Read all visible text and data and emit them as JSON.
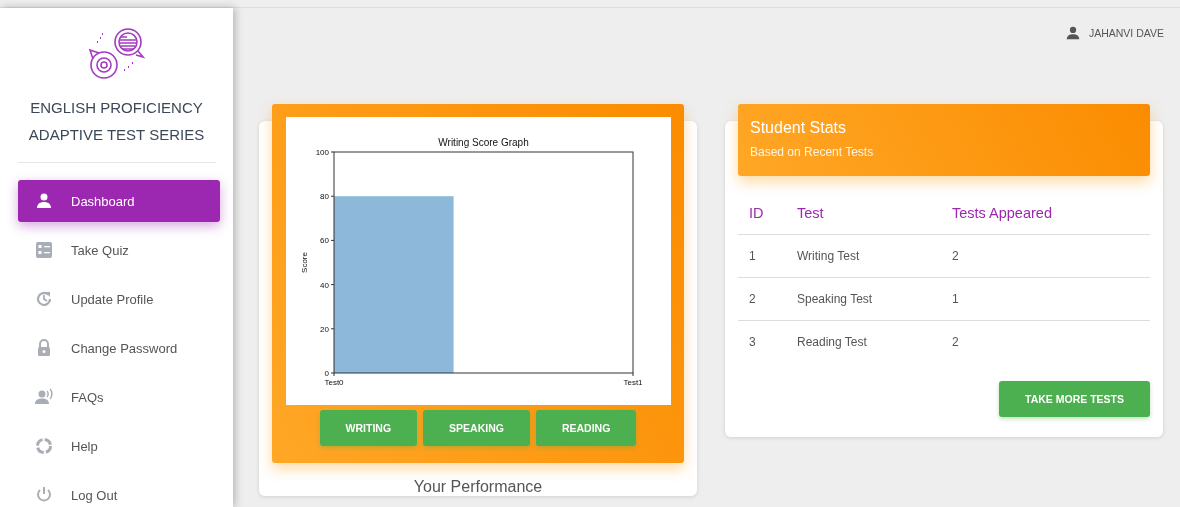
{
  "sidebar": {
    "title_lines": [
      "ENGLISH PROFICIENCY",
      "ADAPTIVE TEST SERIES"
    ],
    "items": [
      {
        "label": "Dashboard",
        "selected": true
      },
      {
        "label": "Take Quiz",
        "selected": false
      },
      {
        "label": "Update Profile",
        "selected": false
      },
      {
        "label": "Change Password",
        "selected": false
      },
      {
        "label": "FAQs",
        "selected": false
      },
      {
        "label": "Help",
        "selected": false
      },
      {
        "label": "Log Out",
        "selected": false
      }
    ]
  },
  "user": {
    "name": "JAHANVI DAVE"
  },
  "performance_card": {
    "chart_data": {
      "type": "bar",
      "title": "Writing Score Graph",
      "ylabel": "Score",
      "categories": [
        "Test0",
        "Test1"
      ],
      "series": [
        {
          "color": "#8db8d9",
          "values": [
            80,
            0
          ]
        }
      ],
      "ylim": [
        0,
        100
      ],
      "yticks": [
        0,
        20,
        40,
        60,
        80,
        100
      ]
    },
    "buttons": [
      "WRITING",
      "SPEAKING",
      "READING"
    ],
    "caption": "Your Performance"
  },
  "stats_card": {
    "title": "Student Stats",
    "subtitle": "Based on Recent Tests",
    "columns": [
      "ID",
      "Test",
      "Tests Appeared"
    ],
    "rows": [
      [
        "1",
        "Writing Test",
        "2"
      ],
      [
        "2",
        "Speaking Test",
        "1"
      ],
      [
        "3",
        "Reading Test",
        "2"
      ]
    ],
    "button": "TAKE MORE TESTS"
  }
}
